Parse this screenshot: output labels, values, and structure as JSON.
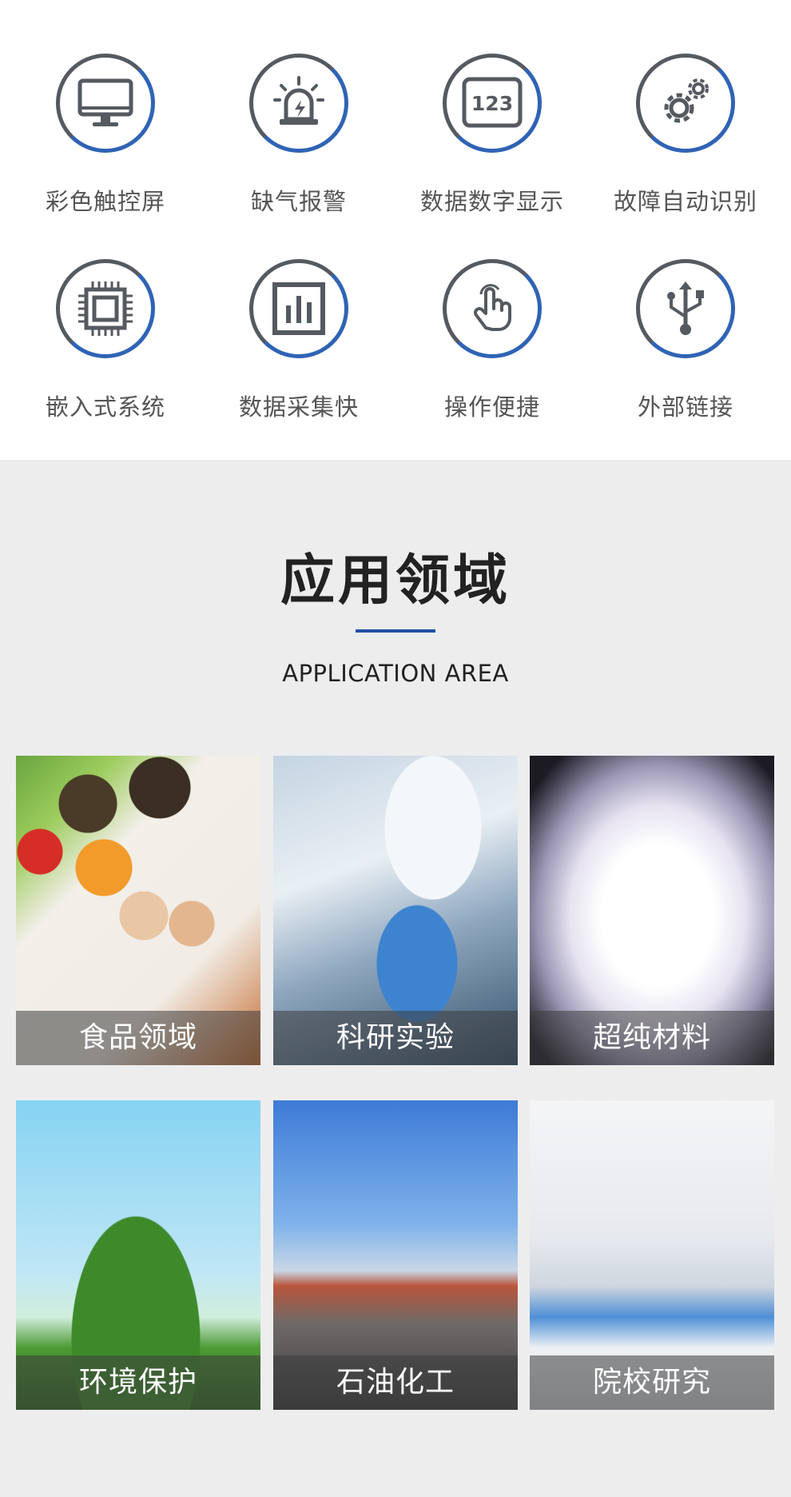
{
  "features": [
    {
      "label": "彩色触控屏",
      "icon": "monitor-icon"
    },
    {
      "label": "缺气报警",
      "icon": "alarm-light-icon"
    },
    {
      "label": "数据数字显示",
      "icon": "digital-display-icon",
      "icon_text": "123"
    },
    {
      "label": "故障自动识别",
      "icon": "gears-icon"
    },
    {
      "label": "嵌入式系统",
      "icon": "chip-icon"
    },
    {
      "label": "数据采集快",
      "icon": "bar-chart-icon"
    },
    {
      "label": "操作便捷",
      "icon": "touch-hand-icon"
    },
    {
      "label": "外部链接",
      "icon": "usb-icon"
    }
  ],
  "applications": {
    "title": "应用领域",
    "subtitle": "APPLICATION AREA",
    "accent_color": "#2250a4",
    "items": [
      {
        "label": "食品领域"
      },
      {
        "label": "科研实验"
      },
      {
        "label": "超纯材料"
      },
      {
        "label": "环境保护"
      },
      {
        "label": "石油化工"
      },
      {
        "label": "院校研究"
      }
    ]
  }
}
